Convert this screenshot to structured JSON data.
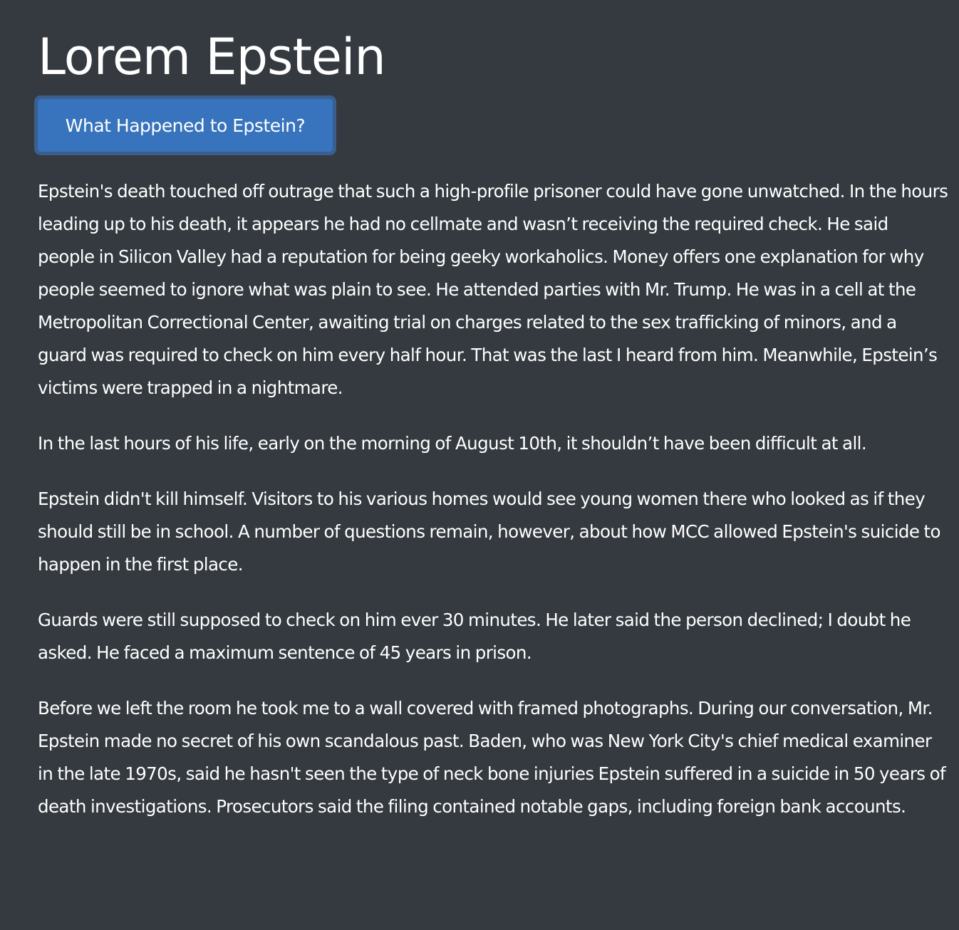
{
  "page": {
    "title": "Lorem Epstein",
    "button_label": "What Happened to Epstein?"
  },
  "paragraphs": [
    "Epstein's death touched off outrage that such a high-profile prisoner could have gone unwatched. In the hours leading up to his death, it appears he had no cellmate and wasn’t receiving the required check. He said people in Silicon Valley had a reputation for being geeky workaholics. Money offers one explanation for why people seemed to ignore what was plain to see. He attended parties with Mr. Trump. He was in a cell at the Metropolitan Correctional Center, awaiting trial on charges related to the sex trafficking of minors, and a guard was required to check on him every half hour. That was the last I heard from him. Meanwhile, Epstein’s victims were trapped in a nightmare.",
    "In the last hours of his life, early on the morning of August 10th, it shouldn’t have been difficult at all.",
    "Epstein didn't kill himself. Visitors to his various homes would see young women there who looked as if they should still be in school. A number of questions remain, however, about how MCC allowed Epstein's suicide to happen in the first place.",
    "Guards were still supposed to check on him ever 30 minutes. He later said the person declined; I doubt he asked. He faced a maximum sentence of 45 years in prison.",
    "Before we left the room he took me to a wall covered with framed photographs. During our conversation, Mr. Epstein made no secret of his own scandalous past. Baden, who was New York City's chief medical examiner in the late 1970s, said he hasn't seen the type of neck bone injuries Epstein suffered in a suicide in 50 years of death investigations. Prosecutors said the filing contained notable gaps, including foreign bank accounts."
  ],
  "colors": {
    "background": "#343a40",
    "text": "#ffffff",
    "button": "#3774bd",
    "button_focus_ring": "#3a5f8f"
  }
}
